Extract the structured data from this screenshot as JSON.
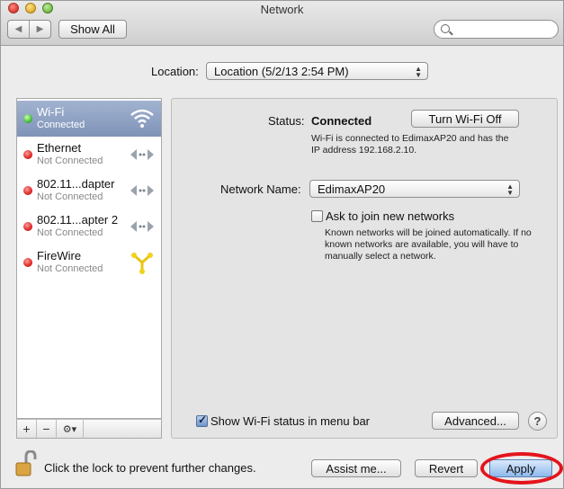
{
  "window": {
    "title": "Network"
  },
  "toolbar": {
    "back_icon": "◀",
    "forward_icon": "▶",
    "show_all_label": "Show All",
    "search_placeholder": ""
  },
  "location": {
    "label": "Location:",
    "value": "Location (5/2/13 2:54 PM)"
  },
  "services": [
    {
      "name": "Wi-Fi",
      "status": "Connected",
      "state": "connected",
      "icon": "wifi-icon",
      "selected": true
    },
    {
      "name": "Ethernet",
      "status": "Not Connected",
      "state": "disconnected",
      "icon": "ethernet-icon",
      "selected": false
    },
    {
      "name": "802.11...dapter",
      "status": "Not Connected",
      "state": "disconnected",
      "icon": "ethernet-icon",
      "selected": false
    },
    {
      "name": "802.11...apter 2",
      "status": "Not Connected",
      "state": "disconnected",
      "icon": "ethernet-icon",
      "selected": false
    },
    {
      "name": "FireWire",
      "status": "Not Connected",
      "state": "disconnected",
      "icon": "firewire-icon",
      "selected": false
    }
  ],
  "list_bar": {
    "add": "+",
    "remove": "−",
    "gear": "⚙▾"
  },
  "detail": {
    "status_label": "Status:",
    "status_value": "Connected",
    "turn_off_label": "Turn Wi-Fi Off",
    "status_desc": "Wi-Fi is connected to EdimaxAP20 and has the IP address 192.168.2.10.",
    "network_name_label": "Network Name:",
    "network_name_value": "EdimaxAP20",
    "ask_label": "Ask to join new networks",
    "ask_checked": false,
    "ask_desc": "Known networks will be joined automatically. If no known networks are available, you will have to manually select a network.",
    "show_status_label": "Show Wi-Fi status in menu bar",
    "show_status_checked": true,
    "advanced_label": "Advanced...",
    "help_label": "?"
  },
  "bottom": {
    "lock_text": "Click the lock to prevent further changes.",
    "assist_label": "Assist me...",
    "revert_label": "Revert",
    "apply_label": "Apply"
  },
  "colors": {
    "selection": "#8fa2c4",
    "connected": "#39b532",
    "disconnected": "#d8201c",
    "highlight": "#e4141c",
    "wifi_blue": "#ffffff",
    "firewire_yellow": "#f2d11c"
  }
}
